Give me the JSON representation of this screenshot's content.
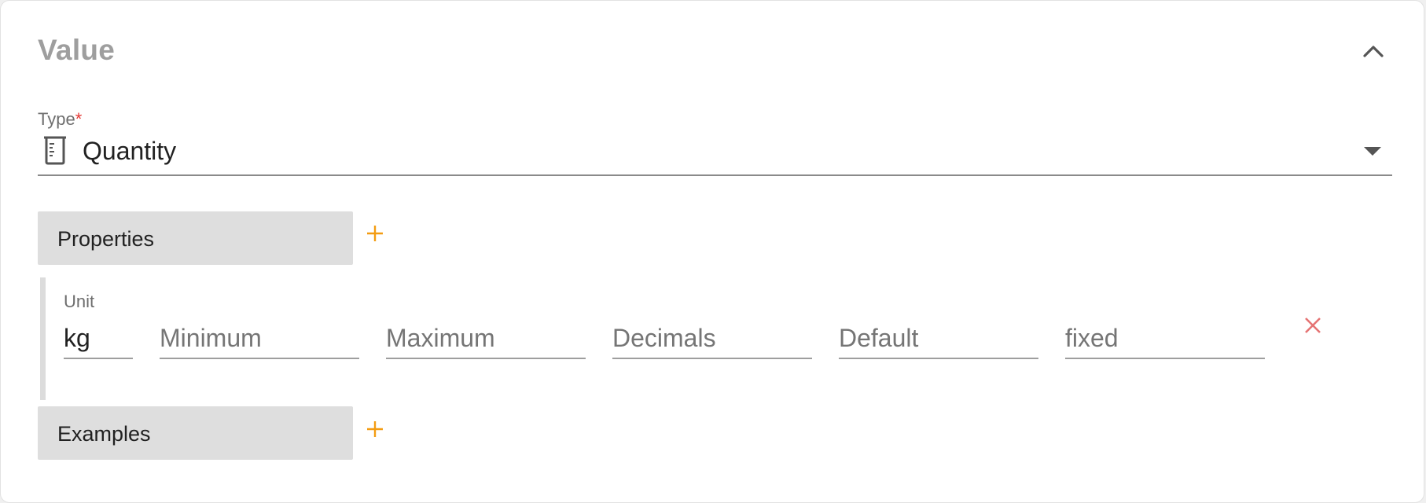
{
  "section": {
    "title": "Value",
    "collapse_icon": "chevron-up-icon"
  },
  "type_field": {
    "label": "Type",
    "required_marker": "*",
    "value": "Quantity",
    "icon": "beaker-icon",
    "dropdown_icon": "caret-down-icon"
  },
  "properties": {
    "label": "Properties",
    "add_icon": "plus-icon",
    "items": [
      {
        "unit": {
          "label": "Unit",
          "value": "kg"
        },
        "minimum": {
          "placeholder": "Minimum",
          "value": ""
        },
        "maximum": {
          "placeholder": "Maximum",
          "value": ""
        },
        "decimals": {
          "placeholder": "Decimals",
          "value": ""
        },
        "default": {
          "placeholder": "Default",
          "value": ""
        },
        "fixed": {
          "placeholder": "fixed",
          "value": ""
        },
        "remove_icon": "close-icon"
      }
    ]
  },
  "examples": {
    "label": "Examples",
    "add_icon": "plus-icon"
  },
  "colors": {
    "accent": "#f39c12",
    "danger": "#e57373",
    "required": "#e53935",
    "title_grey": "#9e9e9e",
    "group_bg": "#dedede"
  }
}
